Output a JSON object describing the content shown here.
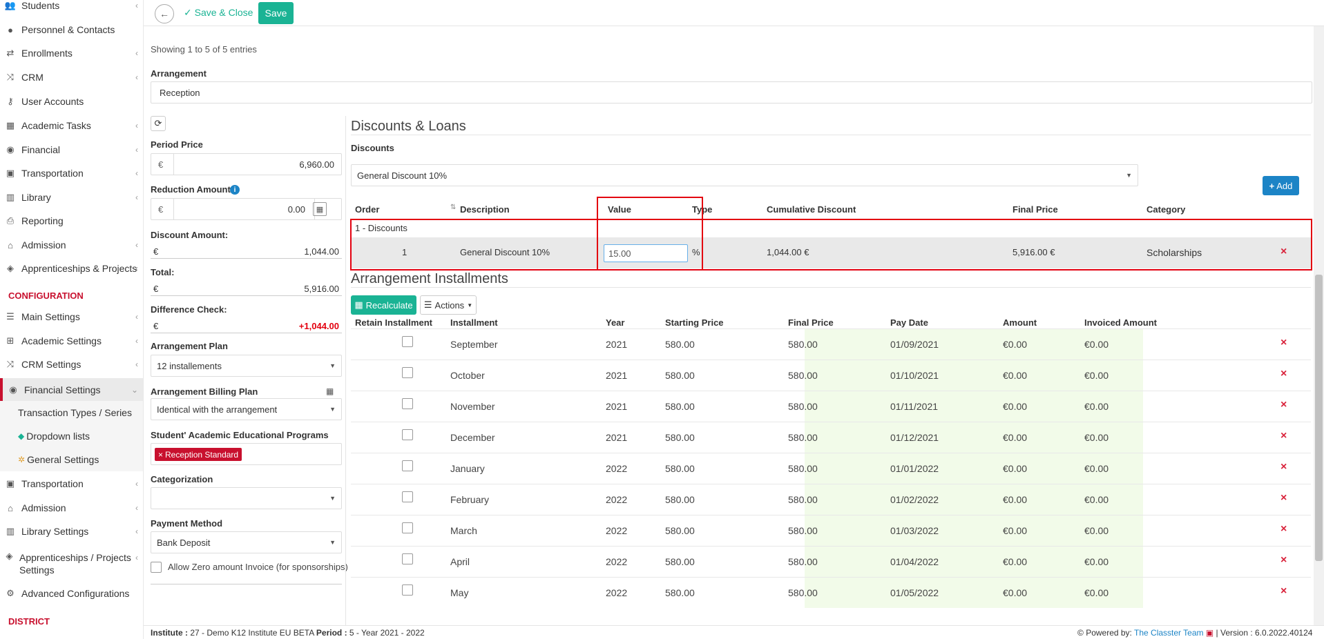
{
  "sidebar": {
    "items": [
      {
        "label": "Students",
        "icon": "users-icon"
      },
      {
        "label": "Personnel & Contacts",
        "icon": "person-icon"
      },
      {
        "label": "Enrollments",
        "icon": "exchange-icon"
      },
      {
        "label": "CRM",
        "icon": "random-icon"
      },
      {
        "label": "User Accounts",
        "icon": "key-icon"
      },
      {
        "label": "Academic Tasks",
        "icon": "grid-icon"
      },
      {
        "label": "Financial",
        "icon": "coins-icon"
      },
      {
        "label": "Transportation",
        "icon": "bus-icon"
      },
      {
        "label": "Library",
        "icon": "books-icon"
      },
      {
        "label": "Reporting",
        "icon": "print-icon"
      },
      {
        "label": "Admission",
        "icon": "bank-icon"
      },
      {
        "label": "Apprenticeships & Projects",
        "icon": "cube-icon"
      }
    ],
    "config_heading": "CONFIGURATION",
    "config_items": [
      {
        "label": "Main Settings",
        "icon": "sliders-icon"
      },
      {
        "label": "Academic Settings",
        "icon": "sitemap-icon"
      },
      {
        "label": "CRM Settings",
        "icon": "random-icon"
      },
      {
        "label": "Financial Settings",
        "icon": "coins-icon"
      }
    ],
    "financial_sub": [
      {
        "label": "Transaction Types / Series"
      },
      {
        "label": "Dropdown lists",
        "icon": "layers-icon"
      },
      {
        "label": "General Settings",
        "icon": "gears-icon"
      }
    ],
    "config_items2": [
      {
        "label": "Transportation",
        "icon": "bus-icon"
      },
      {
        "label": "Admission",
        "icon": "bank-icon"
      },
      {
        "label": "Library Settings",
        "icon": "books-icon"
      },
      {
        "label": "Apprenticeships / Projects Settings",
        "icon": "cube-icon"
      },
      {
        "label": "Advanced Configurations",
        "icon": "gear-icon"
      }
    ],
    "district_heading": "DISTRICT"
  },
  "toolbar": {
    "save_close_label": "Save & Close",
    "save_label": "Save"
  },
  "entries_info": "Showing 1 to 5 of 5 entries",
  "arrangement": {
    "label": "Arrangement",
    "value": "Reception"
  },
  "left_form": {
    "period_price_label": "Period Price",
    "currency": "€",
    "period_price": "6,960.00",
    "reduction_amount_label": "Reduction Amount",
    "reduction_amount": "0.00",
    "discount_amount_label": "Discount Amount:",
    "discount_amount": "1,044.00",
    "total_label": "Total:",
    "total": "5,916.00",
    "difference_check_label": "Difference Check:",
    "difference_check": "+1,044.00",
    "arrangement_plan_label": "Arrangement Plan",
    "arrangement_plan": "12 installements",
    "billing_plan_label": "Arrangement Billing Plan",
    "billing_plan": "Identical with the arrangement",
    "programs_label": "Student' Academic Educational Programs",
    "program_tag": "Reception Standard",
    "categorization_label": "Categorization",
    "categorization": "",
    "payment_method_label": "Payment Method",
    "payment_method": "Bank Deposit",
    "allow_zero_label": "Allow Zero amount Invoice (for sponsorships)"
  },
  "discounts": {
    "section_title": "Discounts & Loans",
    "discounts_label": "Discounts",
    "selected_discount": "General Discount 10%",
    "add_label": "Add",
    "headers": [
      "Order",
      "Description",
      "Value",
      "Type",
      "Cumulative Discount",
      "Final Price",
      "Category"
    ],
    "group_label": "1 - Discounts",
    "row": {
      "order": "1",
      "description": "General Discount 10%",
      "value": "15.00",
      "type": "%",
      "cumulative": "1,044.00 €",
      "final_price": "5,916.00 €",
      "category": "Scholarships"
    }
  },
  "installments": {
    "section_title": "Arrangement Installments",
    "recalculate_label": "Recalculate",
    "actions_label": "Actions",
    "headers": [
      "Retain Installment",
      "Installment",
      "Year",
      "Starting Price",
      "Final Price",
      "Pay Date",
      "Amount",
      "Invoiced Amount"
    ],
    "rows": [
      {
        "installment": "September",
        "year": "2021",
        "start": "580.00",
        "final": "580.00",
        "pay_date": "01/09/2021",
        "amount": "€0.00",
        "invoiced": "€0.00"
      },
      {
        "installment": "October",
        "year": "2021",
        "start": "580.00",
        "final": "580.00",
        "pay_date": "01/10/2021",
        "amount": "€0.00",
        "invoiced": "€0.00"
      },
      {
        "installment": "November",
        "year": "2021",
        "start": "580.00",
        "final": "580.00",
        "pay_date": "01/11/2021",
        "amount": "€0.00",
        "invoiced": "€0.00"
      },
      {
        "installment": "December",
        "year": "2021",
        "start": "580.00",
        "final": "580.00",
        "pay_date": "01/12/2021",
        "amount": "€0.00",
        "invoiced": "€0.00"
      },
      {
        "installment": "January",
        "year": "2022",
        "start": "580.00",
        "final": "580.00",
        "pay_date": "01/01/2022",
        "amount": "€0.00",
        "invoiced": "€0.00"
      },
      {
        "installment": "February",
        "year": "2022",
        "start": "580.00",
        "final": "580.00",
        "pay_date": "01/02/2022",
        "amount": "€0.00",
        "invoiced": "€0.00"
      },
      {
        "installment": "March",
        "year": "2022",
        "start": "580.00",
        "final": "580.00",
        "pay_date": "01/03/2022",
        "amount": "€0.00",
        "invoiced": "€0.00"
      },
      {
        "installment": "April",
        "year": "2022",
        "start": "580.00",
        "final": "580.00",
        "pay_date": "01/04/2022",
        "amount": "€0.00",
        "invoiced": "€0.00"
      },
      {
        "installment": "May",
        "year": "2022",
        "start": "580.00",
        "final": "580.00",
        "pay_date": "01/05/2022",
        "amount": "€0.00",
        "invoiced": "€0.00"
      }
    ]
  },
  "footer": {
    "institute_label": "Institute :",
    "institute_value": "27 - Demo K12 Institute EU BETA",
    "period_label": "Period :",
    "period_value": "5 - Year 2021 - 2022",
    "powered_label": "Powered by:",
    "powered_team": "The Classter Team",
    "version": "| Version : 6.0.2022.40124"
  },
  "colors": {
    "accent_green": "#1ab394",
    "accent_blue": "#1c84c6",
    "brand_red": "#c8102e",
    "highlight_red": "#e3000f"
  }
}
